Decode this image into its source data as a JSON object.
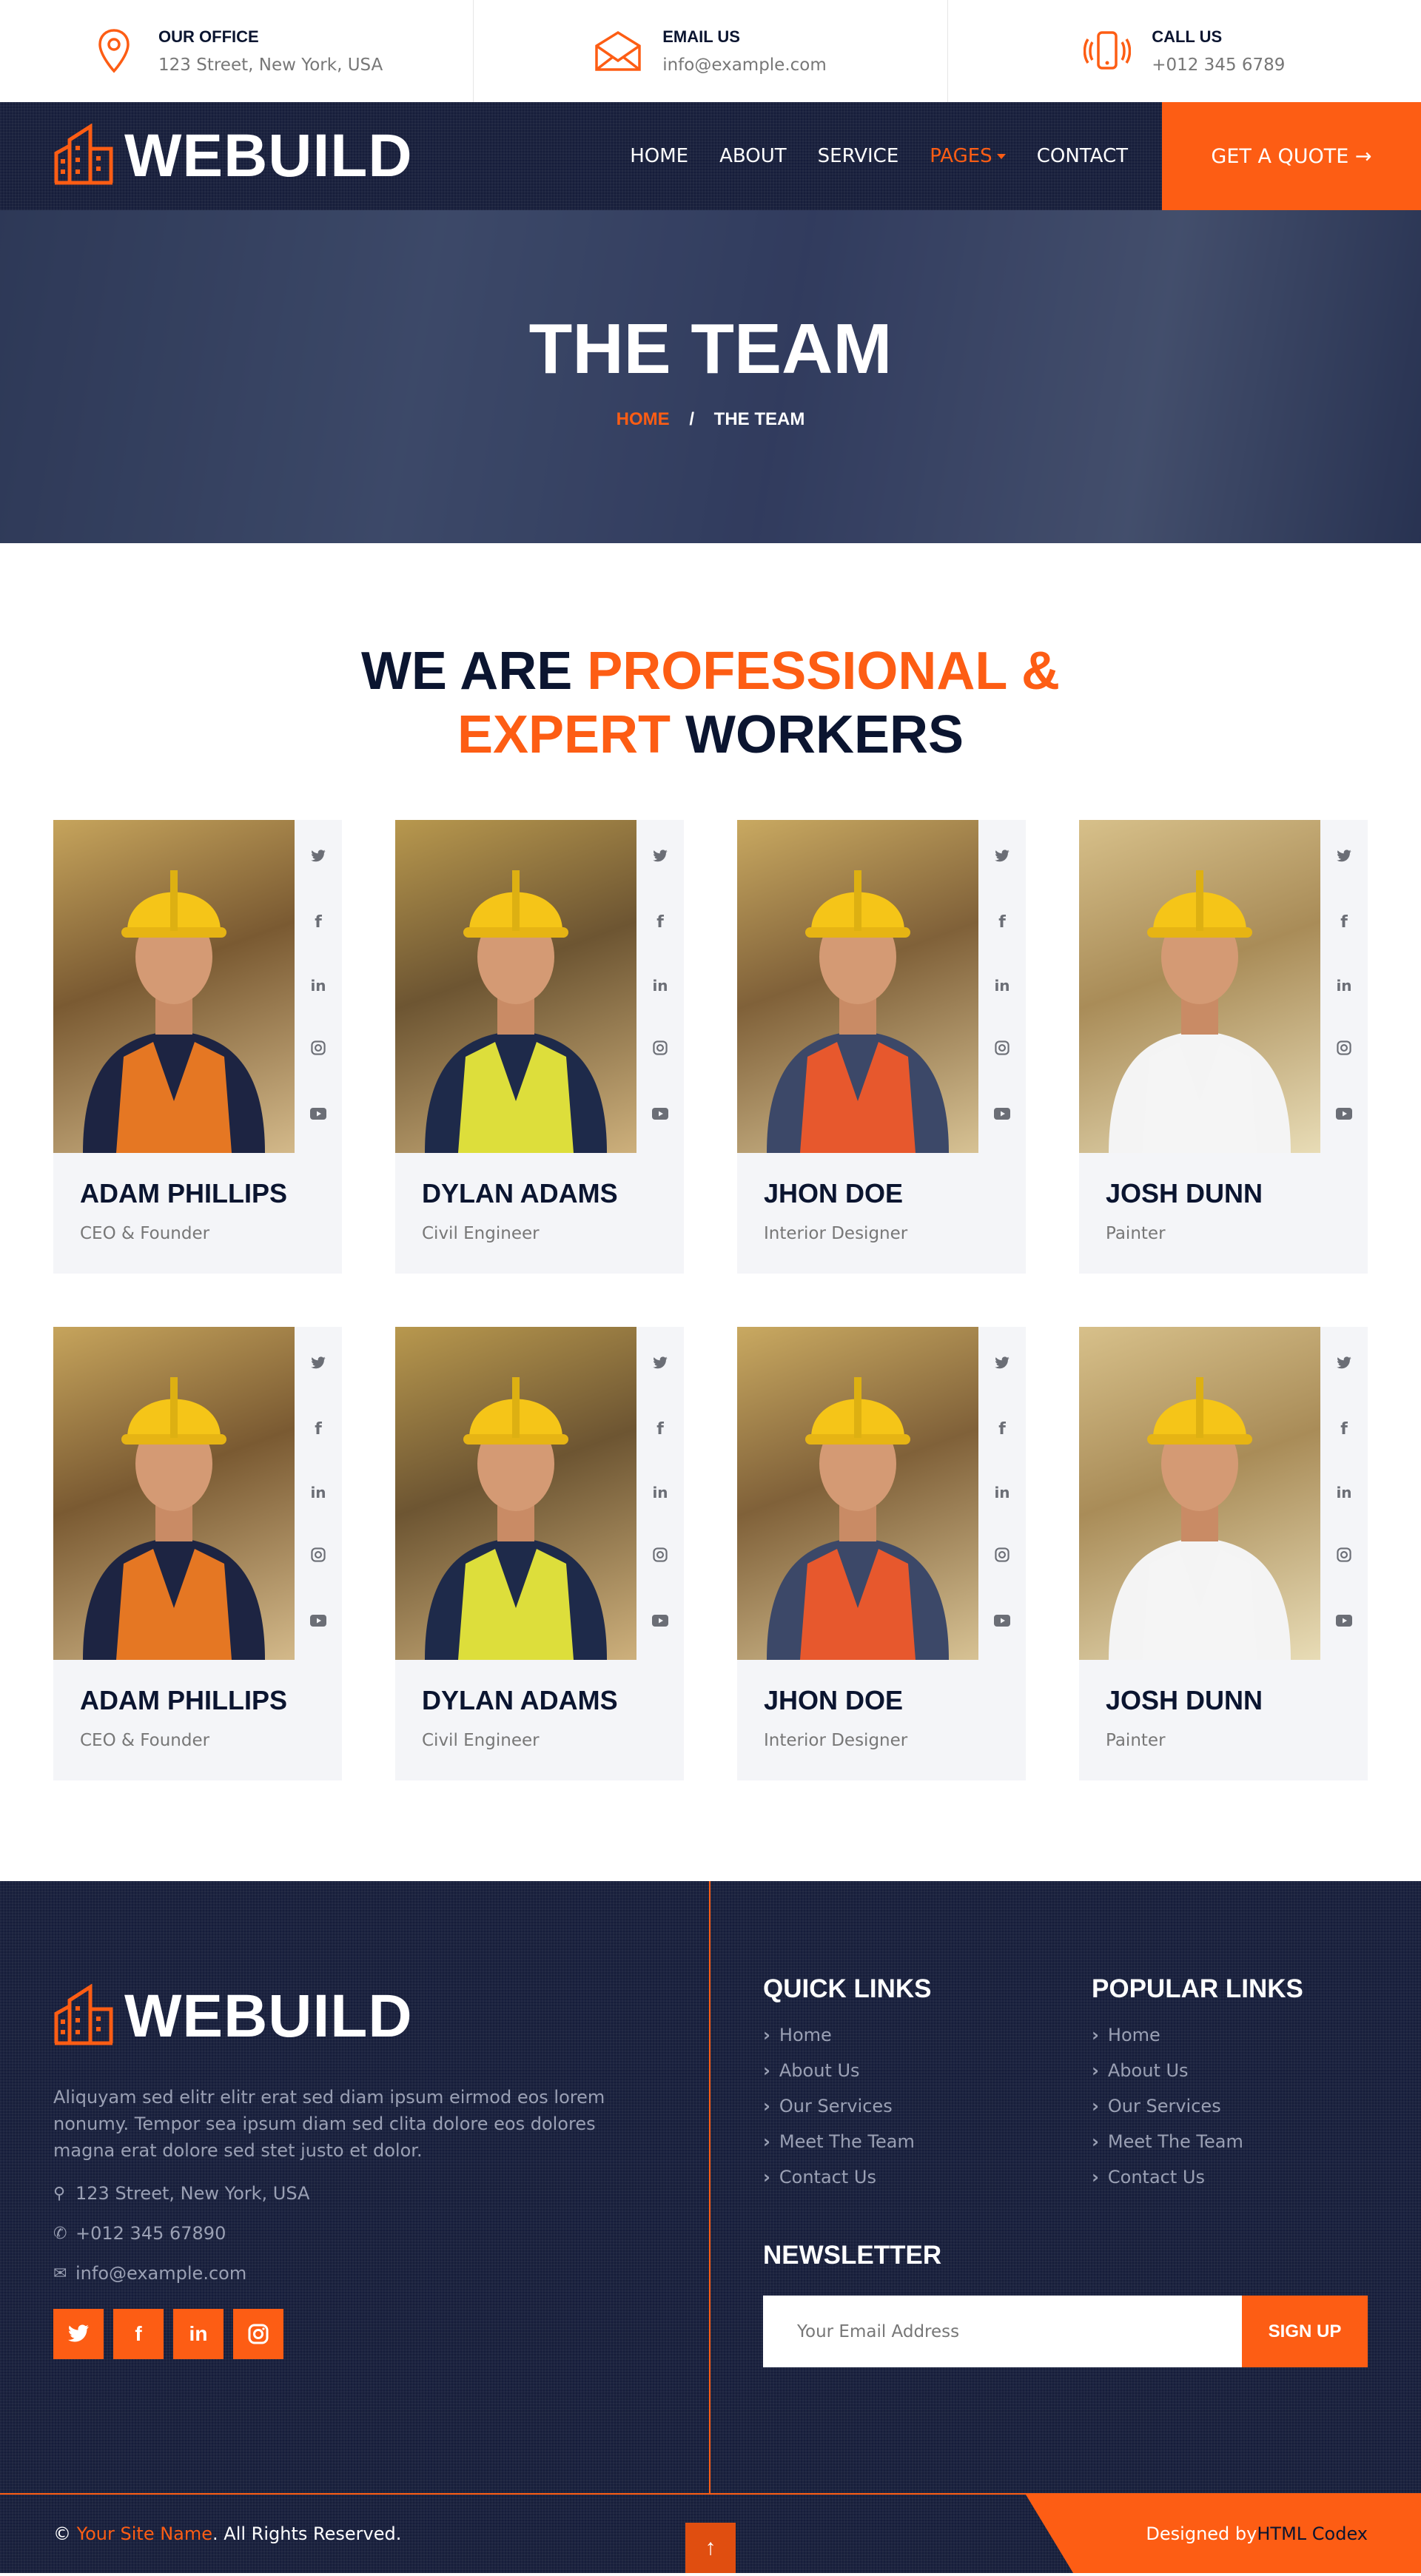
{
  "topbar": {
    "office": {
      "title": "OUR OFFICE",
      "text": "123 Street, New York, USA"
    },
    "email": {
      "title": "EMAIL US",
      "text": "info@example.com"
    },
    "call": {
      "title": "CALL US",
      "text": "+012 345 6789"
    }
  },
  "nav": {
    "brand": "WEBUILD",
    "links": [
      "HOME",
      "ABOUT",
      "SERVICE",
      "PAGES",
      "CONTACT"
    ],
    "active": "PAGES",
    "cta": "GET A QUOTE →"
  },
  "hero": {
    "title": "THE TEAM",
    "crumb_home": "HOME",
    "crumb_sep": "/",
    "crumb_current": "THE TEAM"
  },
  "section": {
    "title_part1": "WE ARE ",
    "title_part2": "PROFESSIONAL &",
    "title_part3": "EXPERT",
    "title_part4": " WORKERS"
  },
  "team": [
    {
      "name": "ADAM PHILLIPS",
      "role": "CEO & Founder"
    },
    {
      "name": "DYLAN ADAMS",
      "role": "Civil Engineer"
    },
    {
      "name": "JHON DOE",
      "role": "Interior Designer"
    },
    {
      "name": "JOSH DUNN",
      "role": "Painter"
    },
    {
      "name": "ADAM PHILLIPS",
      "role": "CEO & Founder"
    },
    {
      "name": "DYLAN ADAMS",
      "role": "Civil Engineer"
    },
    {
      "name": "JHON DOE",
      "role": "Interior Designer"
    },
    {
      "name": "JOSH DUNN",
      "role": "Painter"
    }
  ],
  "footer": {
    "brand": "WEBUILD",
    "about": "Aliquyam sed elitr elitr erat sed diam ipsum eirmod eos lorem nonumy. Tempor sea ipsum diam sed clita dolore eos dolores magna erat dolore sed stet justo et dolor.",
    "address": "123 Street, New York, USA",
    "phone": "+012 345 67890",
    "email": "info@example.com",
    "quick_title": "QUICK LINKS",
    "quick_links": [
      "Home",
      "About Us",
      "Our Services",
      "Meet The Team",
      "Contact Us"
    ],
    "popular_title": "POPULAR LINKS",
    "popular_links": [
      "Home",
      "About Us",
      "Our Services",
      "Meet The Team",
      "Contact Us"
    ],
    "newsletter_title": "NEWSLETTER",
    "newsletter_placeholder": "Your Email Address",
    "newsletter_button": "SIGN UP",
    "copy_prefix": "© ",
    "copy_site": "Your Site Name",
    "copy_suffix": ". All Rights Reserved.",
    "designed_prefix": "Designed by ",
    "designed_link": "HTML Codex"
  },
  "colors": {
    "accent": "#fd5d14",
    "dark": "#161d3a",
    "text_dark": "#0b1530"
  }
}
